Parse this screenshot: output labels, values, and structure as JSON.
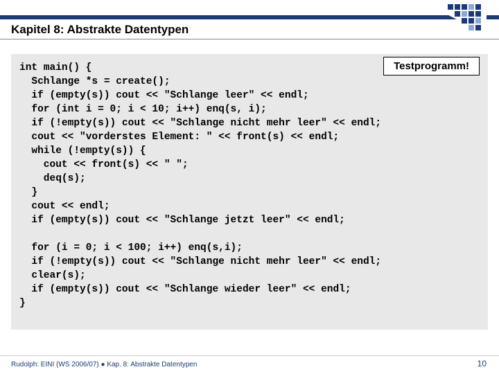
{
  "header": {
    "chapter_title": "Kapitel 8: Abstrakte Datentypen"
  },
  "callout": {
    "label": "Testprogramm!"
  },
  "code": {
    "block": "int main() {\n  Schlange *s = create();\n  if (empty(s)) cout << \"Schlange leer\" << endl;\n  for (int i = 0; i < 10; i++) enq(s, i);\n  if (!empty(s)) cout << \"Schlange nicht mehr leer\" << endl;\n  cout << \"vorderstes Element: \" << front(s) << endl;\n  while (!empty(s)) {\n    cout << front(s) << \" \";\n    deq(s);\n  }\n  cout << endl;\n  if (empty(s)) cout << \"Schlange jetzt leer\" << endl;\n\n  for (i = 0; i < 100; i++) enq(s,i);\n  if (!empty(s)) cout << \"Schlange nicht mehr leer\" << endl;\n  clear(s);\n  if (empty(s)) cout << \"Schlange wieder leer\" << endl;\n}"
  },
  "footer": {
    "text": "Rudolph: EINI (WS 2006/07)  ●  Kap. 8: Abstrakte Datentypen",
    "page": "10"
  }
}
